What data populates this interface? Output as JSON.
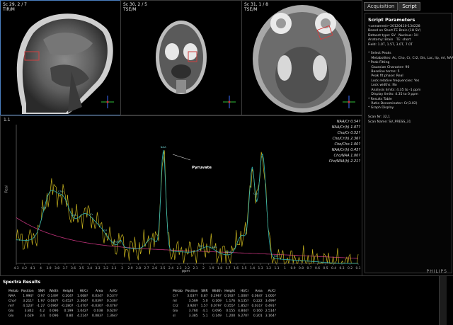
{
  "viewports": [
    {
      "label_line1": "Sc 29, 2 / 7",
      "label_line2": "TIR/M"
    },
    {
      "label_line1": "Sc 30, 2 / 5",
      "label_line2": "TSE/M"
    },
    {
      "label_line1": "Sc 31, 1 / 8",
      "label_line2": "TSE/M"
    }
  ],
  "orientation": {
    "a": "A",
    "p": "P",
    "h": "H"
  },
  "tabs": [
    "Acquisition",
    "Script"
  ],
  "script_panel": {
    "title": "Script Parameters",
    "lines": [
      "<unnamed>-20120410-134228",
      "Based on Short-TE Brain (1H SV)",
      "Dataset type: SV   Nucleus: 1H",
      "Anatomy: Brain   TE: short",
      "Field: 1.0T, 1.5T, 3.0T, 7.0T",
      "",
      "* Select Peaks",
      "   Metabolites: Ac, Cho, Cr, Cr2, Gls, Lac, lip, mI, NAA, sI",
      "* Peak Fitting",
      "   Gaussian Character: 90",
      "   Baseline terms: 5",
      "   Peak fit phase: Real",
      "   Lock relative frequencies: Yes",
      "   Lock widths: No",
      "   Analysis limits: 4.35 to -1 ppm",
      "   Display limits: 4.35 to 0 ppm",
      "* Results Table",
      "   Ratio Denominator: Cr(3.02)",
      "* Graph Display",
      "",
      "Scan Nr: 32,1",
      "Scan Name: SV_PRESS_31"
    ]
  },
  "spectrum": {
    "corner_label": "1.1",
    "y_axis_label": "Real",
    "x_axis_label": "ppm",
    "x_ticks": [
      "4.3",
      "4.2",
      "4.1",
      "4",
      "3.9",
      "3.8",
      "3.7",
      "3.6",
      "3.5",
      "3.4",
      "3.3",
      "3.2",
      "3.1",
      "3",
      "2.9",
      "2.8",
      "2.7",
      "2.6",
      "2.5",
      "2.4",
      "2.3",
      "2.2",
      "2.1",
      "2",
      "1.9",
      "1.8",
      "1.7",
      "1.6",
      "1.5",
      "1.4",
      "1.3",
      "1.2",
      "1.1",
      "1",
      "0.9",
      "0.8",
      "0.7",
      "0.6",
      "0.5",
      "0.4",
      "0.3",
      "0.2",
      "0.1"
    ],
    "annotation": "Pyruvate",
    "peak_labels": [
      "Cr2",
      "Cho",
      "Gls",
      "Cr",
      "mI",
      "Cho?",
      "NAA",
      "Lac",
      "Gls",
      "NAA",
      "Lip",
      "Lac"
    ],
    "ratios": [
      {
        "label": "NAA/Cr",
        "value": "0.54?"
      },
      {
        "label": "NAA/Cr(h)",
        "value": "1.07?"
      },
      {
        "label": "Cho/Cr",
        "value": "0.52?"
      },
      {
        "label": "Cho/Cr(h)",
        "value": "2.36?"
      },
      {
        "label": "Cho/Cho",
        "value": "1.00?"
      },
      {
        "label": "NAA/Cr(h)",
        "value": "0.45?"
      },
      {
        "label": "Cho/NAA",
        "value": "1.00?"
      },
      {
        "label": "Cho/NAA(h)",
        "value": "2.21?"
      }
    ]
  },
  "results": {
    "title": "Spectra Results",
    "headers": [
      "Metab",
      "Position",
      "SNR",
      "Width",
      "Height",
      "Ht/Cr",
      "Area",
      "Ar/Cr"
    ],
    "left_rows": [
      [
        "NAA",
        "1.994?",
        "0.97",
        "0.149?",
        "0.204?",
        "1.068?",
        "0.034?",
        "0.537?"
      ],
      [
        "Cho?",
        "3.211?",
        "1.97",
        "0.087?",
        "0.452?",
        "2.364?",
        "0.039?",
        "0.536?"
      ],
      [
        "mI?",
        "4.123?",
        "-1.27",
        "0.096?",
        "-0.280?",
        "-1.470?",
        "-0.030?",
        "-0.476?"
      ],
      [
        "Glx",
        "3.842",
        "4.2",
        "0.096",
        "0.199",
        "1.042?",
        "0.038",
        "0.620?"
      ],
      [
        "Glx",
        "3.629",
        "3.4",
        "0.096",
        "0.80",
        "4.214?",
        "0.083?",
        "1.364?"
      ]
    ],
    "right_rows": [
      [
        "Cr?",
        "3.037?",
        "0.87",
        "0.296?",
        "0.192?",
        "1.000?",
        "0.064?",
        "1.000?"
      ],
      [
        "mI",
        "3.569",
        "5.0",
        "0.169",
        "1.176",
        "6.135?",
        "0.222",
        "3.499?"
      ],
      [
        "Cr2",
        "3.920?",
        "1.57",
        "0.079?",
        "0.355?",
        "1.852?",
        "0.031?",
        "0.491?"
      ],
      [
        "Glx",
        "3.760",
        "4.1",
        "0.096",
        "0.155",
        "4.844?",
        "0.160",
        "2.514?"
      ],
      [
        "sI",
        "3.385",
        "5.1",
        "0.149",
        "1.200",
        "6.270?",
        "0.201",
        "3.164?"
      ]
    ]
  },
  "brand": "PHILIPS"
}
